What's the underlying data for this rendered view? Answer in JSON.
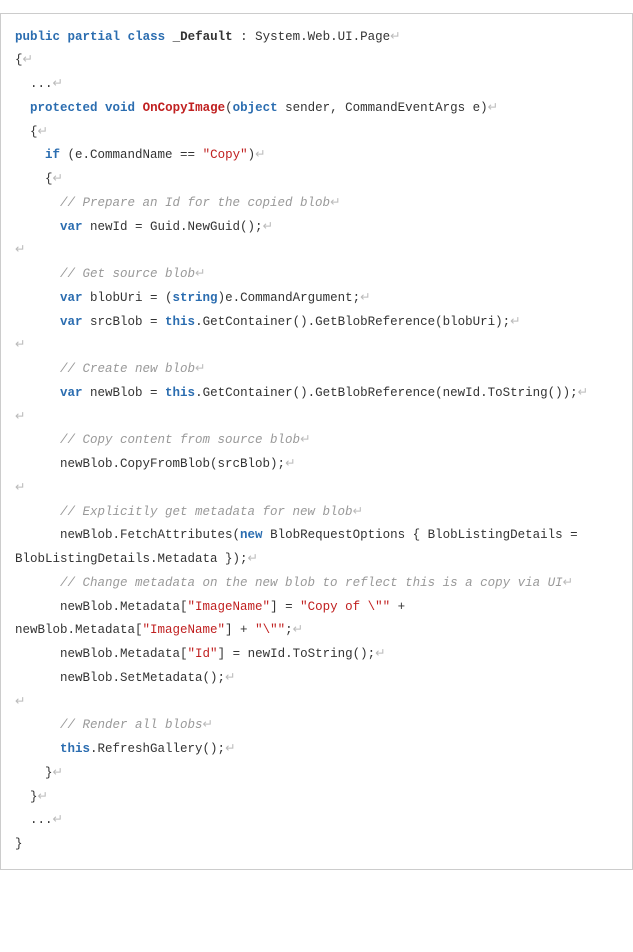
{
  "code": {
    "tokens": [
      {
        "c": "kw",
        "t": "public"
      },
      {
        "t": " "
      },
      {
        "c": "kw",
        "t": "partial"
      },
      {
        "t": " "
      },
      {
        "c": "kw",
        "t": "class"
      },
      {
        "t": " "
      },
      {
        "c": "cls",
        "t": "_Default"
      },
      {
        "t": " : System.Web.UI.Page"
      },
      {
        "c": "nl",
        "t": "↵"
      },
      {
        "t": "\n"
      },
      {
        "t": "{"
      },
      {
        "c": "nl",
        "t": "↵"
      },
      {
        "t": "\n"
      },
      {
        "t": "  ..."
      },
      {
        "c": "nl",
        "t": "↵"
      },
      {
        "t": "\n"
      },
      {
        "t": "  "
      },
      {
        "c": "kw",
        "t": "protected"
      },
      {
        "t": " "
      },
      {
        "c": "kw",
        "t": "void"
      },
      {
        "t": " "
      },
      {
        "c": "mn",
        "t": "OnCopyImage"
      },
      {
        "t": "("
      },
      {
        "c": "kw",
        "t": "object"
      },
      {
        "t": " sender, CommandEventArgs e)"
      },
      {
        "c": "nl",
        "t": "↵"
      },
      {
        "t": "\n"
      },
      {
        "t": "  {"
      },
      {
        "c": "nl",
        "t": "↵"
      },
      {
        "t": "\n"
      },
      {
        "t": "    "
      },
      {
        "c": "kw",
        "t": "if"
      },
      {
        "t": " (e.CommandName == "
      },
      {
        "c": "str",
        "t": "\"Copy\""
      },
      {
        "t": ")"
      },
      {
        "c": "nl",
        "t": "↵"
      },
      {
        "t": "\n"
      },
      {
        "t": "    {"
      },
      {
        "c": "nl",
        "t": "↵"
      },
      {
        "t": "\n"
      },
      {
        "t": "      "
      },
      {
        "c": "cm",
        "t": "// Prepare an Id for the copied blob"
      },
      {
        "c": "nl",
        "t": "↵"
      },
      {
        "t": "\n"
      },
      {
        "t": "      "
      },
      {
        "c": "kw",
        "t": "var"
      },
      {
        "t": " newId = Guid.NewGuid();"
      },
      {
        "c": "nl",
        "t": "↵"
      },
      {
        "t": "\n"
      },
      {
        "c": "nl",
        "t": "↵"
      },
      {
        "t": "\n"
      },
      {
        "t": "      "
      },
      {
        "c": "cm",
        "t": "// Get source blob"
      },
      {
        "c": "nl",
        "t": "↵"
      },
      {
        "t": "\n"
      },
      {
        "t": "      "
      },
      {
        "c": "kw",
        "t": "var"
      },
      {
        "t": " blobUri = ("
      },
      {
        "c": "kw",
        "t": "string"
      },
      {
        "t": ")e.CommandArgument;"
      },
      {
        "c": "nl",
        "t": "↵"
      },
      {
        "t": "\n"
      },
      {
        "t": "      "
      },
      {
        "c": "kw",
        "t": "var"
      },
      {
        "t": " srcBlob = "
      },
      {
        "c": "kw",
        "t": "this"
      },
      {
        "t": ".GetContainer().GetBlobReference(blobUri);"
      },
      {
        "c": "nl",
        "t": "↵"
      },
      {
        "t": "\n"
      },
      {
        "c": "nl",
        "t": "↵"
      },
      {
        "t": "\n"
      },
      {
        "t": "      "
      },
      {
        "c": "cm",
        "t": "// Create new blob"
      },
      {
        "c": "nl",
        "t": "↵"
      },
      {
        "t": "\n"
      },
      {
        "t": "      "
      },
      {
        "c": "kw",
        "t": "var"
      },
      {
        "t": " newBlob = "
      },
      {
        "c": "kw",
        "t": "this"
      },
      {
        "t": ".GetContainer().GetBlobReference(newId.ToString());"
      },
      {
        "c": "nl",
        "t": "↵"
      },
      {
        "t": "\n"
      },
      {
        "c": "nl",
        "t": "↵"
      },
      {
        "t": "\n"
      },
      {
        "t": "      "
      },
      {
        "c": "cm",
        "t": "// Copy content from source blob"
      },
      {
        "c": "nl",
        "t": "↵"
      },
      {
        "t": "\n"
      },
      {
        "t": "      newBlob.CopyFromBlob(srcBlob);"
      },
      {
        "c": "nl",
        "t": "↵"
      },
      {
        "t": "\n"
      },
      {
        "c": "nl",
        "t": "↵"
      },
      {
        "t": "\n"
      },
      {
        "t": "      "
      },
      {
        "c": "cm",
        "t": "// Explicitly get metadata for new blob"
      },
      {
        "c": "nl",
        "t": "↵"
      },
      {
        "t": "\n"
      },
      {
        "t": "      newBlob.FetchAttributes("
      },
      {
        "c": "kw",
        "t": "new"
      },
      {
        "t": " BlobRequestOptions { BlobListingDetails = BlobListingDetails.Metadata });"
      },
      {
        "c": "nl",
        "t": "↵"
      },
      {
        "t": "\n"
      },
      {
        "t": "      "
      },
      {
        "c": "cm",
        "t": "// Change metadata on the new blob to reflect this is a copy via UI"
      },
      {
        "c": "nl",
        "t": "↵"
      },
      {
        "t": "\n"
      },
      {
        "t": "      newBlob.Metadata["
      },
      {
        "c": "str",
        "t": "\"ImageName\""
      },
      {
        "t": "] = "
      },
      {
        "c": "str",
        "t": "\"Copy of \\\"\""
      },
      {
        "t": " + newBlob.Metadata["
      },
      {
        "c": "str",
        "t": "\"ImageName\""
      },
      {
        "t": "] + "
      },
      {
        "c": "str",
        "t": "\"\\\"\""
      },
      {
        "t": ";"
      },
      {
        "c": "nl",
        "t": "↵"
      },
      {
        "t": "\n"
      },
      {
        "t": "      newBlob.Metadata["
      },
      {
        "c": "str",
        "t": "\"Id\""
      },
      {
        "t": "] = newId.ToString();"
      },
      {
        "c": "nl",
        "t": "↵"
      },
      {
        "t": "\n"
      },
      {
        "t": "      newBlob.SetMetadata();"
      },
      {
        "c": "nl",
        "t": "↵"
      },
      {
        "t": "\n"
      },
      {
        "c": "nl",
        "t": "↵"
      },
      {
        "t": "\n"
      },
      {
        "t": "      "
      },
      {
        "c": "cm",
        "t": "// Render all blobs"
      },
      {
        "c": "nl",
        "t": "↵"
      },
      {
        "t": "\n"
      },
      {
        "t": "      "
      },
      {
        "c": "kw",
        "t": "this"
      },
      {
        "t": ".RefreshGallery();"
      },
      {
        "c": "nl",
        "t": "↵"
      },
      {
        "t": "\n"
      },
      {
        "t": "    }"
      },
      {
        "c": "nl",
        "t": "↵"
      },
      {
        "t": "\n"
      },
      {
        "t": "  }"
      },
      {
        "c": "nl",
        "t": "↵"
      },
      {
        "t": "\n"
      },
      {
        "t": "  ..."
      },
      {
        "c": "nl",
        "t": "↵"
      },
      {
        "t": "\n"
      },
      {
        "t": "}"
      }
    ]
  }
}
